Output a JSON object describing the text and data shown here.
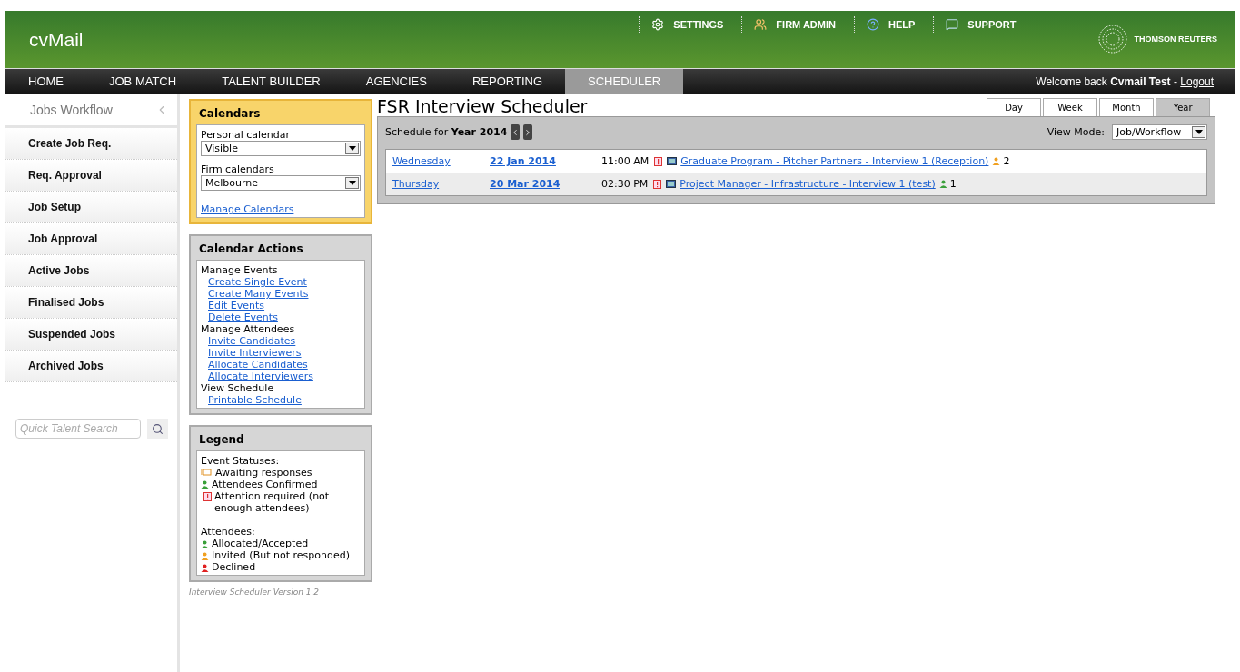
{
  "header": {
    "logo": "cvMail",
    "links": [
      {
        "kind": "gear",
        "label": "SETTINGS"
      },
      {
        "kind": "people",
        "label": "FIRM ADMIN"
      },
      {
        "kind": "help",
        "label": "HELP"
      },
      {
        "kind": "chat",
        "label": "SUPPORT"
      }
    ],
    "brand": "THOMSON REUTERS"
  },
  "nav": {
    "tabs": [
      {
        "label": "HOME",
        "selected": false
      },
      {
        "label": "JOB MATCH",
        "selected": false
      },
      {
        "label": "TALENT BUILDER",
        "selected": false
      },
      {
        "label": "AGENCIES",
        "selected": false
      },
      {
        "label": "REPORTING",
        "selected": false
      },
      {
        "label": "SCHEDULER",
        "selected": true
      }
    ],
    "welcome": "Welcome back",
    "user": "Cvmail Test",
    "separator": "-",
    "logout": "Logout"
  },
  "sidebar": {
    "title": "Jobs Workflow",
    "items": [
      "Create Job Req.",
      "Req. Approval",
      "Job Setup",
      "Job Approval",
      "Active Jobs",
      "Finalised Jobs",
      "Suspended Jobs",
      "Archived Jobs"
    ],
    "search_placeholder": "Quick Talent Search"
  },
  "calendars": {
    "title": "Calendars",
    "personal_label": "Personal calendar",
    "personal_value": "Visible",
    "firm_label": "Firm calendars",
    "firm_value": "Melbourne",
    "manage_link": "Manage Calendars"
  },
  "actions": {
    "title": "Calendar Actions",
    "groups": [
      {
        "heading": "Manage Events",
        "links": [
          "Create Single Event",
          "Create Many Events",
          "Edit Events",
          "Delete Events"
        ]
      },
      {
        "heading": "Manage Attendees",
        "links": [
          "Invite Candidates",
          "Invite Interviewers",
          "Allocate Candidates",
          "Allocate Interviewers"
        ]
      },
      {
        "heading": "View Schedule",
        "links": [
          "Printable Schedule"
        ]
      }
    ]
  },
  "legend": {
    "title": "Legend",
    "statuses_heading": "Event Statuses:",
    "statuses": [
      {
        "kind": "awaiting",
        "label": "Awaiting responses"
      },
      {
        "kind": "person",
        "color": "#3aa03a",
        "label": "Attendees Confirmed"
      },
      {
        "kind": "attention",
        "label": "Attention required (not enough attendees)"
      }
    ],
    "attendees_heading": "Attendees:",
    "attendees": [
      {
        "color": "#3aa03a",
        "label": "Allocated/Accepted"
      },
      {
        "color": "#f0a020",
        "label": "Invited (But not responded)"
      },
      {
        "color": "#e02020",
        "label": "Declined"
      }
    ],
    "version": "Interview Scheduler Version 1.2"
  },
  "scheduler": {
    "title": "FSR Interview Scheduler",
    "view_tabs": [
      {
        "label": "Day",
        "selected": false
      },
      {
        "label": "Week",
        "selected": false
      },
      {
        "label": "Month",
        "selected": false
      },
      {
        "label": "Year",
        "selected": true
      }
    ],
    "schedule_for": "Schedule for",
    "period": "Year 2014",
    "view_mode_label": "View Mode:",
    "view_mode": "Job/Workflow",
    "events": [
      {
        "day": "Wednesday",
        "date": "22 Jan 2014",
        "time": "11:00 AM",
        "title": "Graduate Program - Pitcher Partners - Interview 1 (Reception)",
        "color": "#f0a020",
        "count": "2"
      },
      {
        "day": "Thursday",
        "date": "20 Mar 2014",
        "time": "02:30 PM",
        "title": "Project Manager - Infrastructure - Interview 1 (test)",
        "color": "#3aa03a",
        "count": "1"
      }
    ]
  }
}
